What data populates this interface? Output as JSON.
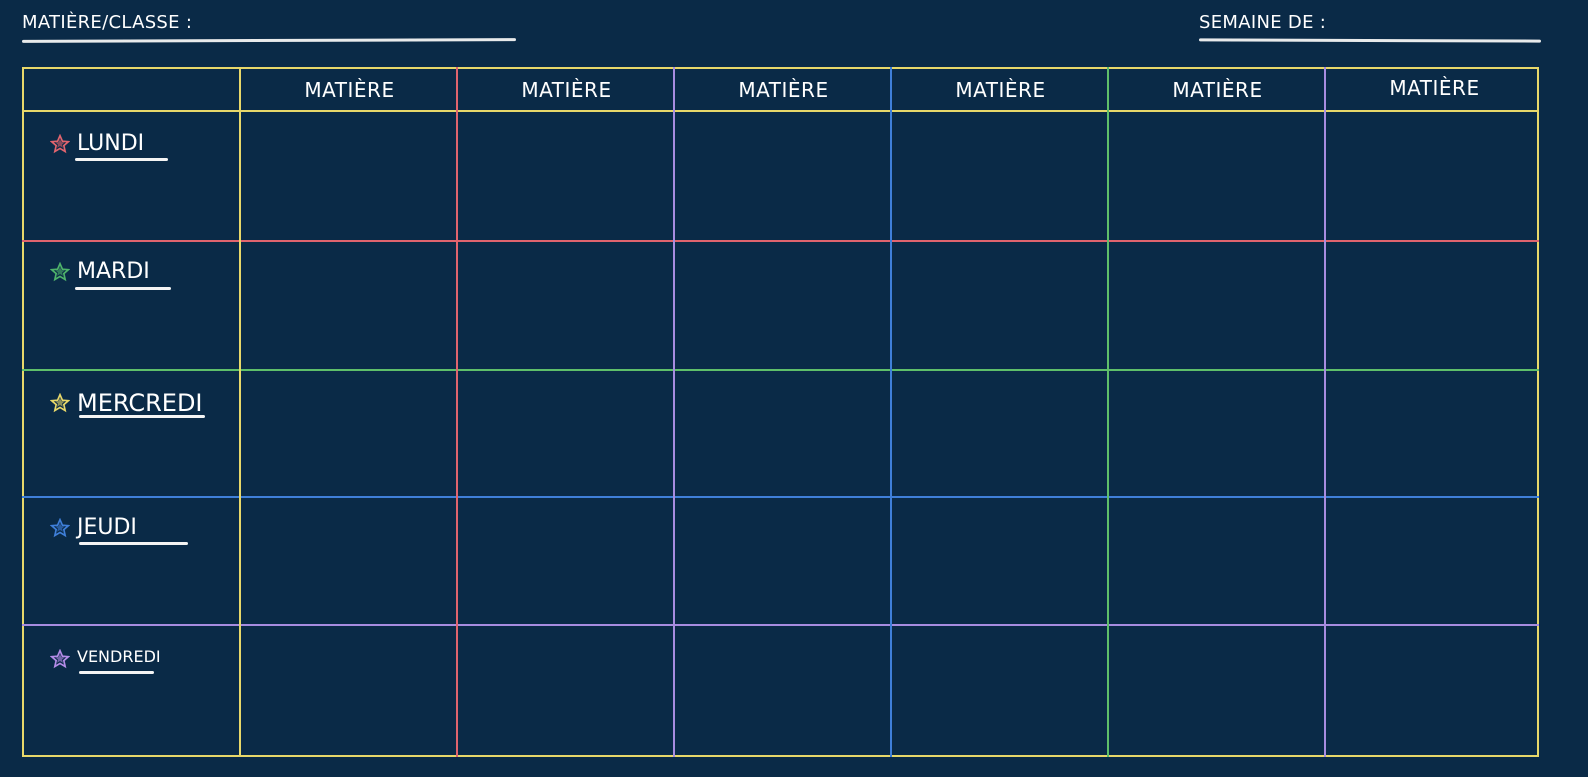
{
  "header": {
    "matiere_classe_label": "MATIÈRE/CLASSE :",
    "semaine_label": "SEMAINE DE :"
  },
  "columns": [
    {
      "label": "MATIÈRE"
    },
    {
      "label": "MATIÈRE"
    },
    {
      "label": "MATIÈRE"
    },
    {
      "label": "MATIÈRE"
    },
    {
      "label": "MATIÈRE"
    },
    {
      "label": "MATIÈRE"
    }
  ],
  "days": [
    {
      "label": "LUNDI",
      "star_color": "#e0646e",
      "line_color": "#e0646e"
    },
    {
      "label": "MARDI",
      "star_color": "#4fb36a",
      "line_color": "#5fbf6a"
    },
    {
      "label": "MERCREDI",
      "star_color": "#e8d86a",
      "line_color": "#3f7fd9"
    },
    {
      "label": "JEUDI",
      "star_color": "#3f7fd9",
      "line_color": "#a78ce0"
    },
    {
      "label": "VENDREDI",
      "star_color": "#b48ce8",
      "line_color": null
    }
  ],
  "colors": {
    "background": "#0a2a47",
    "border": "#e8d86a",
    "column_lines": [
      "#e8d86a",
      "#e0646e",
      "#a78ce0",
      "#3f7fd9",
      "#5fbf6a",
      "#a78ce0"
    ]
  }
}
